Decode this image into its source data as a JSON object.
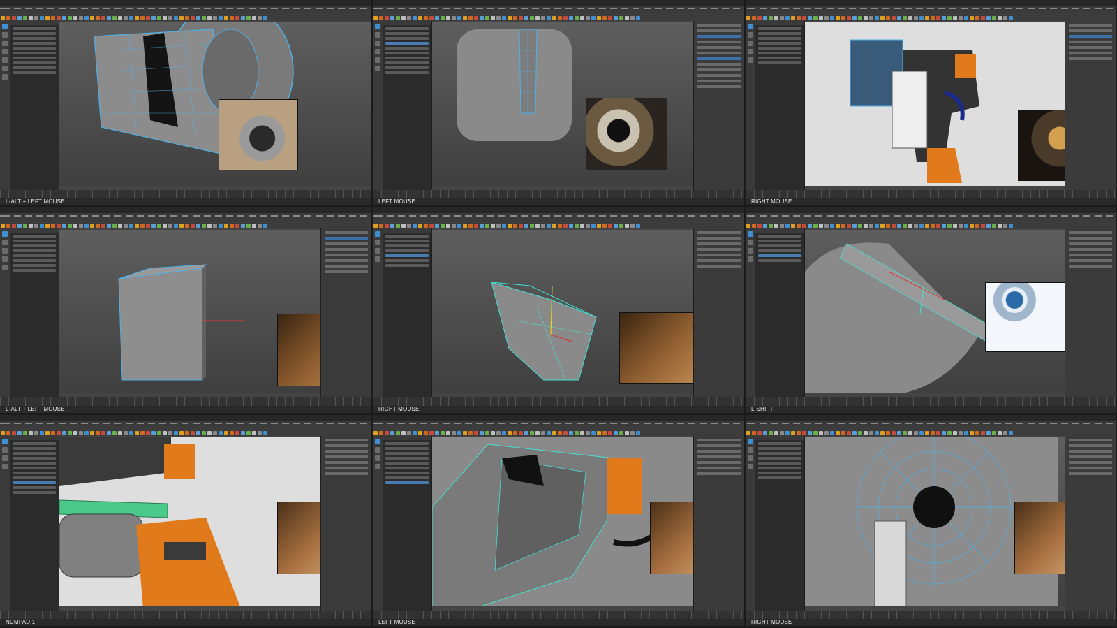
{
  "captions": {
    "t1": "L-ALT + LEFT MOUSE",
    "t2": "LEFT MOUSE",
    "t3": "RIGHT MOUSE",
    "t4": "L-ALT + LEFT MOUSE",
    "t5": "RIGHT MOUSE",
    "t6": "L-SHIFT",
    "t7": "NUMPAD 1",
    "t8": "LEFT MOUSE",
    "t9": "RIGHT MOUSE"
  },
  "colors": {
    "ui_dark": "#2b2b2b",
    "ui_mid": "#3c3c3c",
    "viewport": "#5a5a5a",
    "wire_cyan": "#43e2d4",
    "select_blue": "#3f8fd3",
    "walle_orange": "#e07a1a",
    "reference_brown": "#8a5a2e"
  },
  "icons": [
    "select-tool-icon",
    "move-tool-icon",
    "rotate-tool-icon",
    "scale-tool-icon",
    "shelf-icon"
  ]
}
